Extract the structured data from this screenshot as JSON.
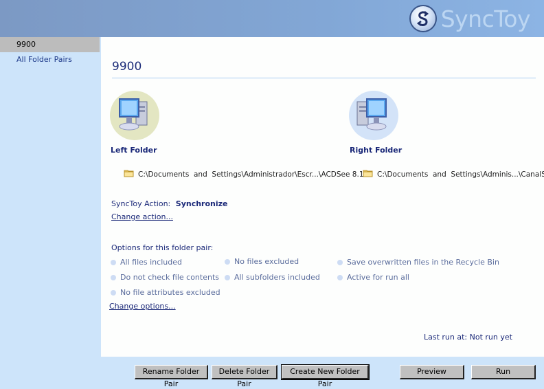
{
  "app": {
    "logo_text": "SyncToy",
    "logo_icon": "sync-arrows-icon"
  },
  "sidebar": {
    "items": [
      {
        "label": "9900",
        "active": true
      },
      {
        "label": "All Folder Pairs",
        "active": false
      }
    ]
  },
  "main": {
    "title": "9900",
    "left_folder": {
      "label": "Left Folder",
      "icon": "computer-icon",
      "path": "C:\\Documents  and  Settings\\Administrador\\Escr...\\ACDSee 8.1"
    },
    "right_folder": {
      "label": "Right Folder",
      "icon": "computer-icon",
      "path": "C:\\Documents  and  Settings\\Adminis...\\CanalSerie"
    },
    "action": {
      "label": "SyncToy Action:",
      "value": "Synchronize",
      "change_link": "Change action..."
    },
    "options": {
      "header": "Options for this folder pair:",
      "items": [
        "All files included",
        "No files excluded",
        "Save overwritten files in the Recycle Bin",
        "Do not check file contents",
        "All subfolders included",
        "Active for run all",
        "No file attributes excluded"
      ],
      "change_link": "Change options..."
    },
    "last_run": "Last run at: Not run yet"
  },
  "buttons": {
    "rename": "Rename Folder Pair",
    "delete": "Delete Folder Pair",
    "create": "Create New Folder Pair",
    "preview": "Preview",
    "run": "Run"
  },
  "colors": {
    "header_bg": "#82a7d6",
    "sidebar_bg": "#cde4fa",
    "accent_text": "#1a2878",
    "option_text": "#5a6c9c"
  }
}
